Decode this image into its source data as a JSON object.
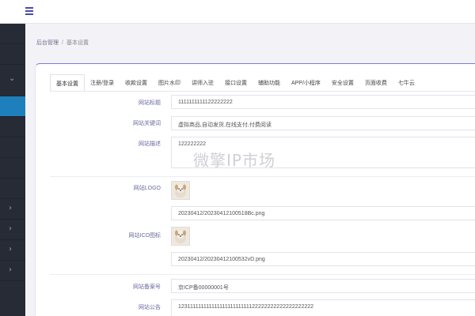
{
  "header": {
    "menu_icon": "hamburger-icon"
  },
  "breadcrumb": {
    "root": "后台管理",
    "separator": "/",
    "current": "基本设置"
  },
  "tabs": [
    {
      "label": "基本设置",
      "active": true
    },
    {
      "label": "注册/登录"
    },
    {
      "label": "收款设置"
    },
    {
      "label": "图片水印"
    },
    {
      "label": "讲师入驻"
    },
    {
      "label": "接口设置"
    },
    {
      "label": "辅助功能"
    },
    {
      "label": "APP/小程序"
    },
    {
      "label": "安全设置"
    },
    {
      "label": "页面收费"
    },
    {
      "label": "七牛云"
    }
  ],
  "form": {
    "site_title": {
      "label": "网站标题",
      "value": "1111111111122222222"
    },
    "site_keywords": {
      "label": "网站关键词",
      "value": "虚拟商品,自动发货,在线支付,付费阅读"
    },
    "site_desc": {
      "label": "网站描述",
      "value": "122222222"
    },
    "site_logo": {
      "label": "网站LOGO",
      "path": "20230412/20230412100518Bc.png"
    },
    "site_ico": {
      "label": "网站ICO图标",
      "path": "20230412/20230412100532vD.png"
    },
    "icp": {
      "label": "网站备案号",
      "value": "京ICP备00000001号"
    },
    "notice": {
      "label": "网站公告",
      "value": "12311111111111111111111111122222222222222222222"
    }
  },
  "watermark": "微擎IP市场",
  "sidebar": {
    "icon": "chevron-icon"
  }
}
